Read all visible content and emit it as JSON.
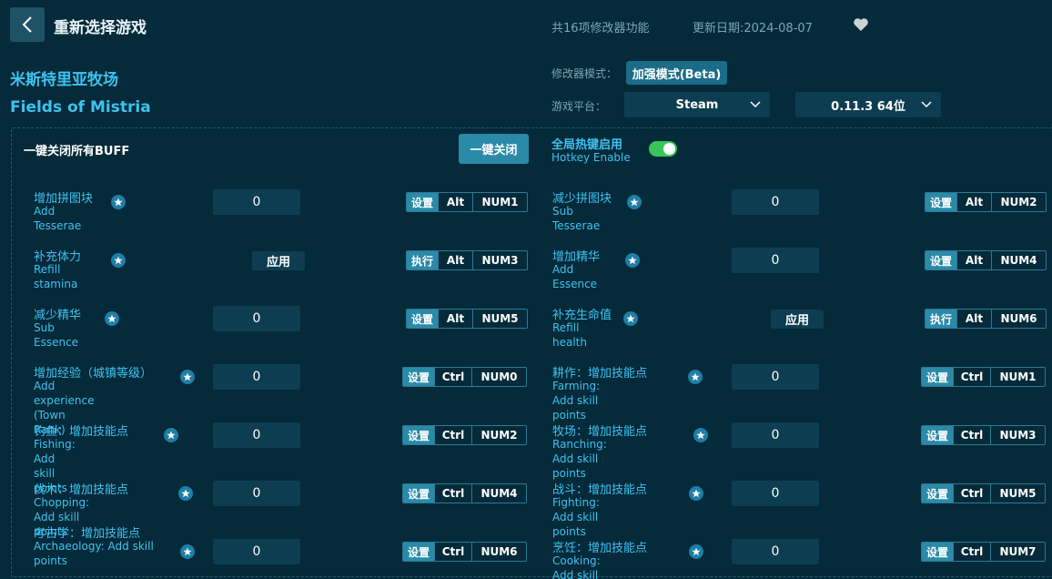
{
  "header": {
    "title": "重新选择游戏",
    "feature_count": "共16项修改器功能",
    "update_date": "更新日期:2024-08-07"
  },
  "game": {
    "title_cn": "米斯特里亚牧场",
    "title_en": "Fields of Mistria"
  },
  "settings": {
    "mode_label": "修改器模式：",
    "mode_value": "加强模式(Beta)",
    "platform_label": "游戏平台：",
    "platform_value": "Steam",
    "version_value": "0.11.3 64位"
  },
  "panel": {
    "buff_label": "一键关闭所有BUFF",
    "close_all_label": "一键关闭",
    "hotkey_cn": "全局热键启用",
    "hotkey_en": "Hotkey Enable",
    "hotkey_enabled": true
  },
  "cheats": [
    {
      "cn": "增加拼图块",
      "en": "Add Tesserae",
      "control": "input",
      "value": "0",
      "action": "设置",
      "mod": "Alt",
      "key": "NUM1"
    },
    {
      "cn": "减少拼图块",
      "en": "Sub Tesserae",
      "control": "input",
      "value": "0",
      "action": "设置",
      "mod": "Alt",
      "key": "NUM2"
    },
    {
      "cn": "补充体力",
      "en": "Refill stamina",
      "control": "button",
      "value": "应用",
      "action": "执行",
      "mod": "Alt",
      "key": "NUM3"
    },
    {
      "cn": "增加精华",
      "en": "Add Essence",
      "control": "input",
      "value": "0",
      "action": "设置",
      "mod": "Alt",
      "key": "NUM4"
    },
    {
      "cn": "减少精华",
      "en": "Sub Essence",
      "control": "input",
      "value": "0",
      "action": "设置",
      "mod": "Alt",
      "key": "NUM5"
    },
    {
      "cn": "补充生命值",
      "en": "Refill health",
      "control": "button",
      "value": "应用",
      "action": "执行",
      "mod": "Alt",
      "key": "NUM6"
    },
    {
      "cn": "增加经验（城镇等级）",
      "en": "Add experience (Town Rank)",
      "control": "input",
      "value": "0",
      "action": "设置",
      "mod": "Ctrl",
      "key": "NUM0"
    },
    {
      "cn": "耕作：增加技能点",
      "en": "Farming: Add skill points",
      "control": "input",
      "value": "0",
      "action": "设置",
      "mod": "Ctrl",
      "key": "NUM1"
    },
    {
      "cn": "钓鱼：增加技能点",
      "en": "Fishing: Add skill points",
      "control": "input",
      "value": "0",
      "action": "设置",
      "mod": "Ctrl",
      "key": "NUM2"
    },
    {
      "cn": "牧场：增加技能点",
      "en": "Ranching: Add skill points",
      "control": "input",
      "value": "0",
      "action": "设置",
      "mod": "Ctrl",
      "key": "NUM3"
    },
    {
      "cn": "伐木：增加技能点",
      "en": "Chopping: Add skill points",
      "control": "input",
      "value": "0",
      "action": "设置",
      "mod": "Ctrl",
      "key": "NUM4"
    },
    {
      "cn": "战斗：增加技能点",
      "en": "Fighting: Add skill points",
      "control": "input",
      "value": "0",
      "action": "设置",
      "mod": "Ctrl",
      "key": "NUM5"
    },
    {
      "cn": "考古学：增加技能点",
      "en": "Archaeology: Add skill points",
      "control": "input",
      "value": "0",
      "action": "设置",
      "mod": "Ctrl",
      "key": "NUM6"
    },
    {
      "cn": "烹饪：增加技能点",
      "en": "Cooking: Add skill points",
      "control": "input",
      "value": "0",
      "action": "设置",
      "mod": "Ctrl",
      "key": "NUM7"
    }
  ]
}
